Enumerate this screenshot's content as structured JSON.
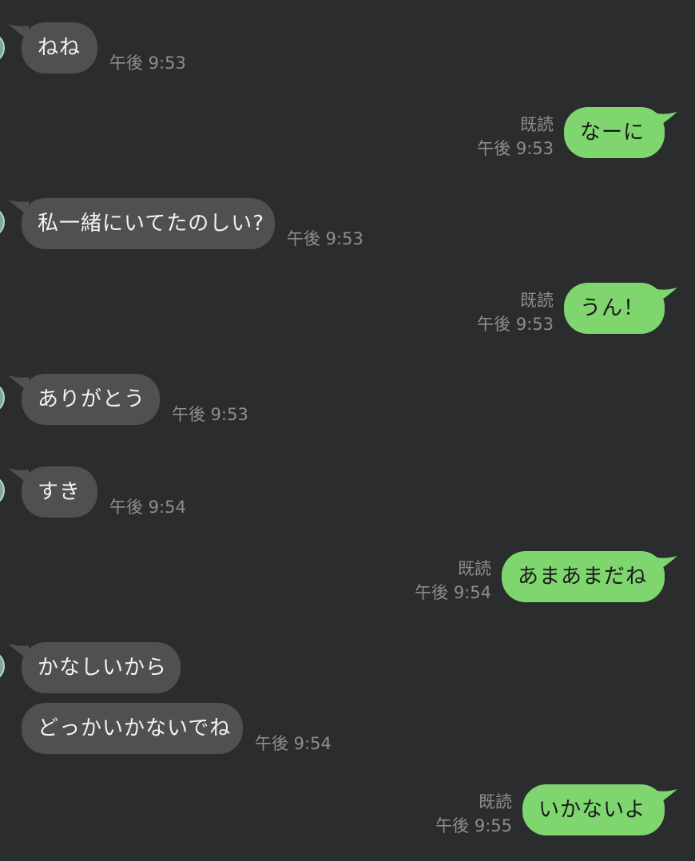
{
  "colors": {
    "background": "#2b2c2e",
    "incoming_bubble": "#505050",
    "outgoing_bubble": "#7fd66f",
    "meta_text": "#8e8e8e"
  },
  "messages": [
    {
      "direction": "in",
      "text": "ねね",
      "time": "午後 9:53"
    },
    {
      "direction": "out",
      "text": "なーに",
      "read": "既読",
      "time": "午後 9:53"
    },
    {
      "direction": "in",
      "text": "私一緒にいてたのしい?",
      "time": "午後 9:53"
    },
    {
      "direction": "out",
      "text": "うん！",
      "read": "既読",
      "time": "午後 9:53"
    },
    {
      "direction": "in",
      "text": "ありがとう",
      "time": "午後 9:53"
    },
    {
      "direction": "in",
      "text": "すき",
      "time": "午後 9:54"
    },
    {
      "direction": "out",
      "text": "あまあまだね",
      "read": "既読",
      "time": "午後 9:54"
    },
    {
      "direction": "in",
      "text": "かなしいから"
    },
    {
      "direction": "in",
      "text": "どっかいかないでね",
      "time": "午後 9:54"
    },
    {
      "direction": "out",
      "text": "いかないよ",
      "read": "既読",
      "time": "午後 9:55"
    }
  ]
}
